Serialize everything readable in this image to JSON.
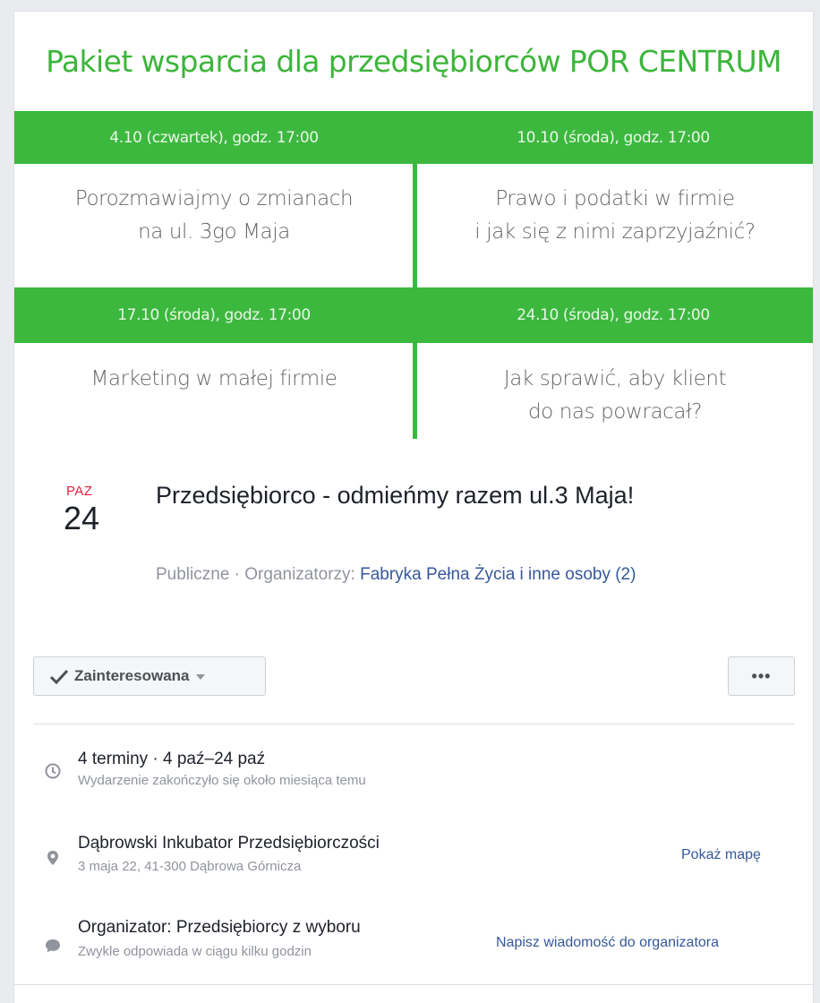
{
  "banner": {
    "title": "Pakiet wsparcia dla przedsiębiorców POR CENTRUM",
    "sessions": [
      {
        "date": "4.10 (czwartek), godz. 17:00",
        "line1": "Porozmawiajmy o zmianach",
        "line2": "na ul. 3go Maja"
      },
      {
        "date": "10.10 (środa), godz. 17:00",
        "line1": "Prawo i podatki w firmie",
        "line2": "i jak się z nimi zaprzyjaźnić?"
      },
      {
        "date": "17.10 (środa), godz. 17:00",
        "line1": "Marketing w małej firmie",
        "line2": ""
      },
      {
        "date": "24.10 (środa), godz. 17:00",
        "line1": "Jak sprawić, aby klient",
        "line2": "do nas powracał?"
      }
    ],
    "colors": {
      "green": "#3cb83e",
      "title_green": "#3cb53a"
    }
  },
  "event": {
    "date_month": "PAZ",
    "date_day": "24",
    "title": "Przedsiębiorco - odmieńmy razem ul.3 Maja!",
    "meta_prefix": "Publiczne · Organizatorzy: ",
    "meta_link": "Fabryka Pełna Życia i inne osoby (2)"
  },
  "buttons": {
    "interested_label": "Zainteresowana",
    "more_label": "•••"
  },
  "details": {
    "time": {
      "icon": "clock-icon",
      "main": "4 terminy · 4 paź–24 paź",
      "sub": "Wydarzenie zakończyło się około miesiąca temu"
    },
    "location": {
      "icon": "location-pin-icon",
      "main": "Dąbrowski Inkubator Przedsiębiorczości",
      "sub": "3 maja 22, 41-300 Dąbrowa Górnicza",
      "link": "Pokaż mapę"
    },
    "organizer": {
      "icon": "message-bubble-icon",
      "main": "Organizator: Przedsiębiorcy z wyboru",
      "sub": "Zwykle odpowiada w ciągu kilku godzin",
      "link": "Napisz wiadomość do organizatora"
    }
  },
  "colors": {
    "accent_red": "#e41e3f",
    "link_blue": "#365899",
    "text": "#1d2129",
    "muted": "#90949c"
  }
}
